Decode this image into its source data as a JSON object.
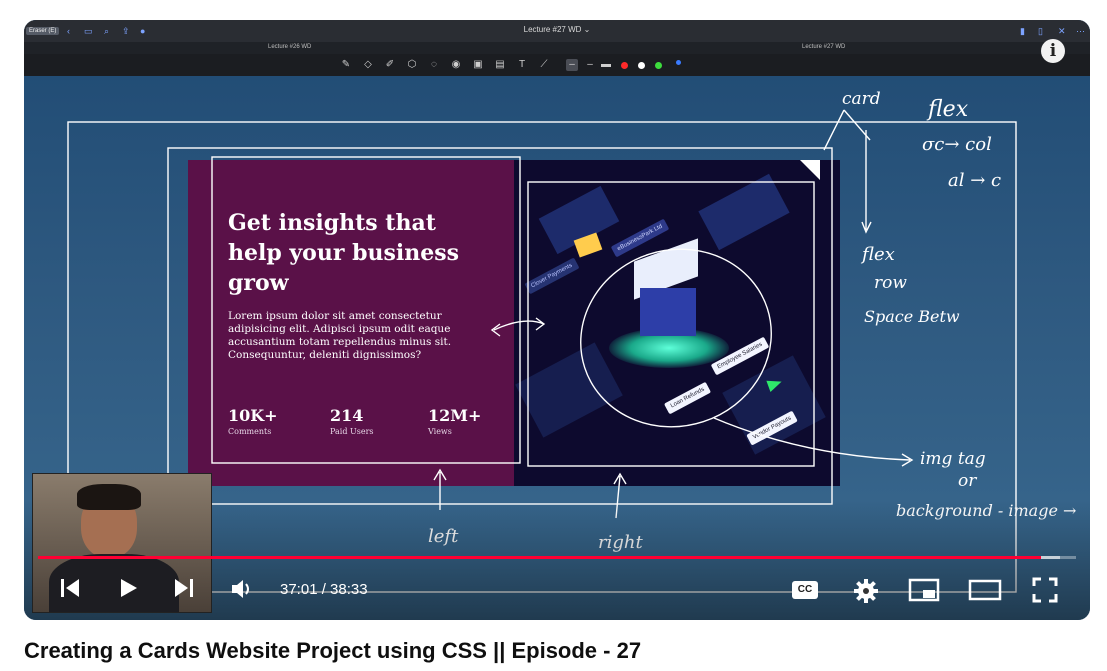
{
  "app": {
    "eraser_label": "Eraser (E)",
    "window_title": "Lecture #27 WD ⌄",
    "tabs": [
      "Lecture #26 WD",
      "Lecture #27 WD"
    ]
  },
  "card": {
    "headline": "Get insights that help your business grow",
    "paragraph": "Lorem ipsum dolor sit amet consectetur adipisicing elit. Adipisci ipsum odit eaque accusantium totam repellendus minus sit. Consequuntur, deleniti dignissimos?",
    "stats": [
      {
        "value": "10K+",
        "label": "Comments"
      },
      {
        "value": "214",
        "label": "Paid Users"
      },
      {
        "value": "12M+",
        "label": "Views"
      }
    ],
    "illustration_labels": [
      "eBusinessPark Ltd",
      "Employee Salaries",
      "Loan Refunds",
      "Vendor Payouts",
      "Clover Payments"
    ]
  },
  "annotations": {
    "card": "card",
    "flex_col": "flex",
    "flex_col_2": "σc→ col",
    "flex_col_3": "al → c",
    "flex_row": "flex",
    "flex_row_2": "row",
    "flex_row_3": "Space Betw",
    "img": "img tag",
    "or": "or",
    "bg": "background - image →",
    "left": "left",
    "right": "right"
  },
  "player": {
    "current_time": "37:01",
    "duration": "38:33",
    "time_display": "37:01 / 38:33",
    "progress": 0.9665,
    "buffered": 0.985,
    "cc_label": "CC",
    "progress_color": "#ff0033"
  },
  "video": {
    "title": "Creating a Cards Website Project using CSS || Episode - 27"
  }
}
